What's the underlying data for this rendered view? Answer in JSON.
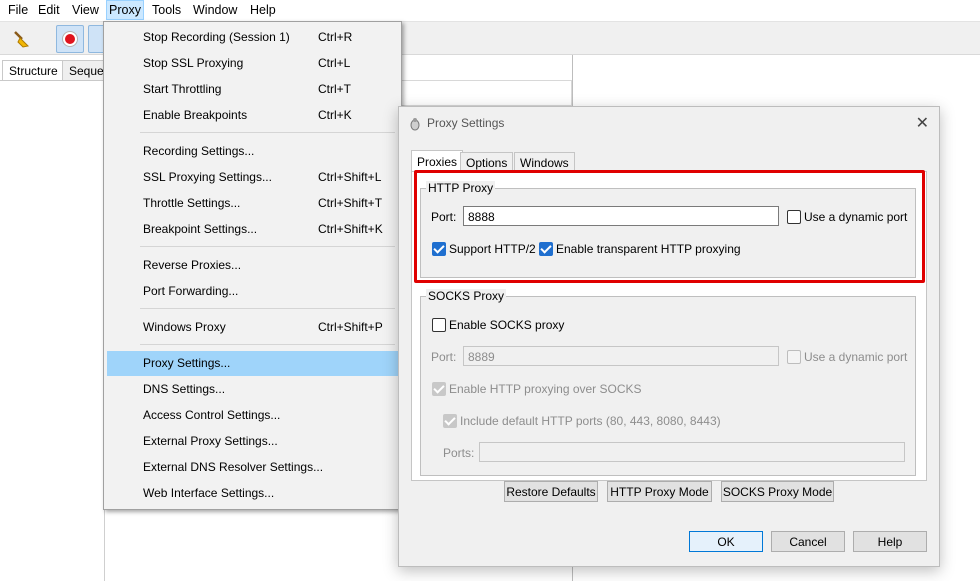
{
  "menubar": {
    "items": [
      "File",
      "Edit",
      "View",
      "Proxy",
      "Tools",
      "Window",
      "Help"
    ]
  },
  "left_tabs": [
    "Structure",
    "Sequer"
  ],
  "proxy_menu": {
    "items": [
      {
        "label": "Stop Recording (Session 1)",
        "shortcut": "Ctrl+R"
      },
      {
        "label": "Stop SSL Proxying",
        "shortcut": "Ctrl+L"
      },
      {
        "label": "Start Throttling",
        "shortcut": "Ctrl+T"
      },
      {
        "label": "Enable Breakpoints",
        "shortcut": "Ctrl+K"
      },
      {
        "label": "Recording Settings...",
        "shortcut": ""
      },
      {
        "label": "SSL Proxying Settings...",
        "shortcut": "Ctrl+Shift+L"
      },
      {
        "label": "Throttle Settings...",
        "shortcut": "Ctrl+Shift+T"
      },
      {
        "label": "Breakpoint Settings...",
        "shortcut": "Ctrl+Shift+K"
      },
      {
        "label": "Reverse Proxies...",
        "shortcut": ""
      },
      {
        "label": "Port Forwarding...",
        "shortcut": ""
      },
      {
        "label": "Windows Proxy",
        "shortcut": "Ctrl+Shift+P"
      },
      {
        "label": "Proxy Settings...",
        "shortcut": ""
      },
      {
        "label": "DNS Settings...",
        "shortcut": ""
      },
      {
        "label": "Access Control Settings...",
        "shortcut": ""
      },
      {
        "label": "External Proxy Settings...",
        "shortcut": ""
      },
      {
        "label": "External DNS Resolver Settings...",
        "shortcut": ""
      },
      {
        "label": "Web Interface Settings...",
        "shortcut": ""
      }
    ],
    "highlighted": "Proxy Settings..."
  },
  "dialog": {
    "title": "Proxy Settings",
    "tabs": [
      "Proxies",
      "Options",
      "Windows"
    ],
    "active_tab": "Proxies",
    "http_proxy": {
      "group_title": "HTTP Proxy",
      "port_label": "Port:",
      "port_value": "8888",
      "dynamic_port_label": "Use a dynamic port",
      "support_http2_label": "Support HTTP/2",
      "transparent_label": "Enable transparent HTTP proxying"
    },
    "socks_proxy": {
      "group_title": "SOCKS Proxy",
      "enable_label": "Enable SOCKS proxy",
      "port_label": "Port:",
      "port_value": "8889",
      "dynamic_port_label": "Use a dynamic port",
      "http_over_socks_label": "Enable HTTP proxying over SOCKS",
      "include_ports_label": "Include default HTTP ports (80, 443, 8080, 8443)",
      "ports_label": "Ports:",
      "ports_value": ""
    },
    "buttons": {
      "restore": "Restore Defaults",
      "http_mode": "HTTP Proxy Mode",
      "socks_mode": "SOCKS Proxy Mode",
      "ok": "OK",
      "cancel": "Cancel",
      "help": "Help"
    }
  },
  "colors": {
    "menu_highlight": "#9fd4fa",
    "annotation_box": "#e00000",
    "checkbox_checked": "#1f6fcf"
  }
}
